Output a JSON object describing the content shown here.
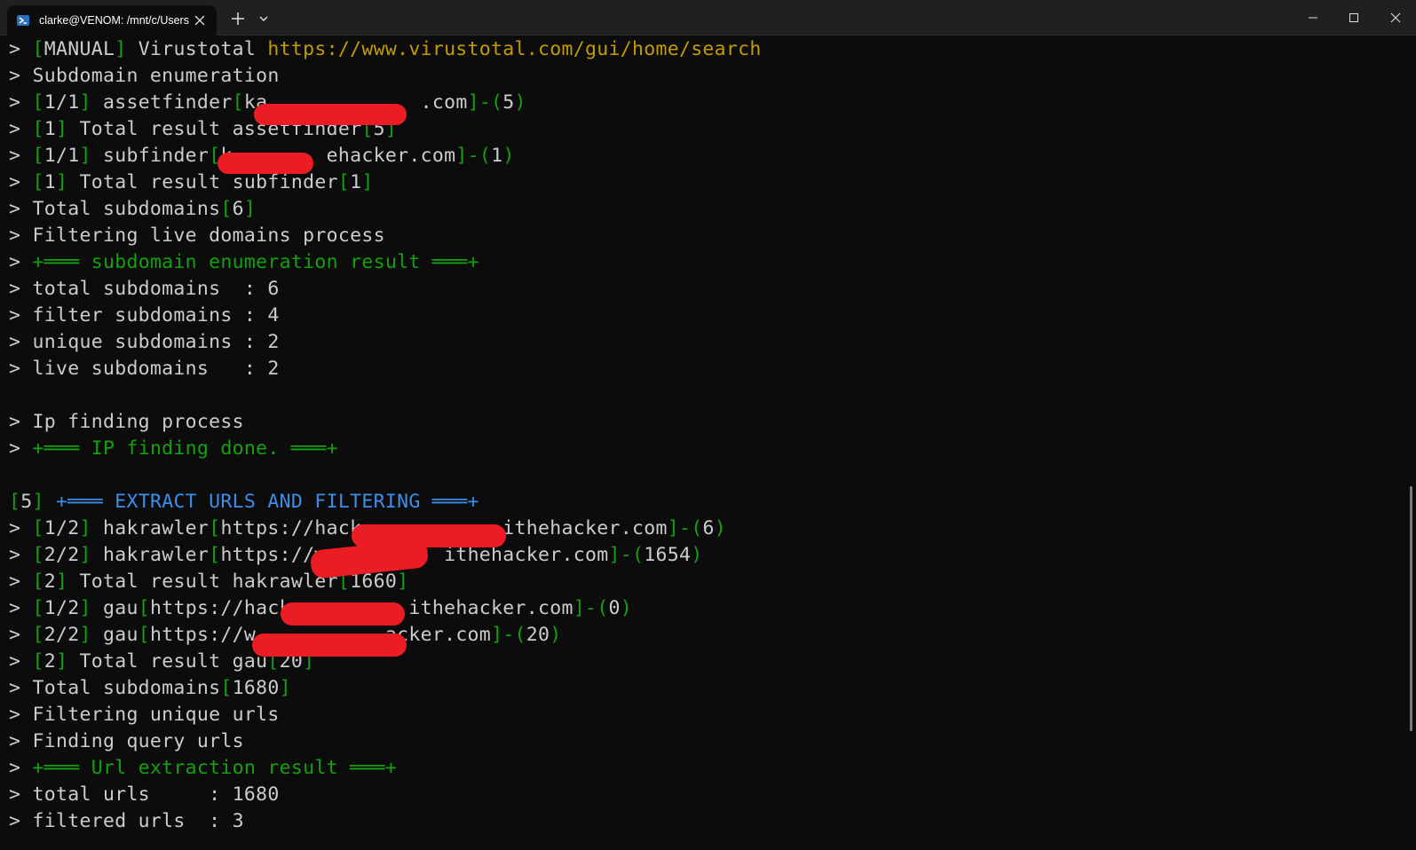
{
  "window": {
    "tab_title": "clarke@VENOM: /mnt/c/Users",
    "icons": {
      "tab": "powershell-icon",
      "close_tab": "close-icon",
      "new_tab": "plus-icon",
      "dropdown": "chevron-down-icon",
      "minimize": "minimize-icon",
      "maximize": "maximize-icon",
      "close": "close-icon"
    }
  },
  "colors": {
    "background": "#0c0c0c",
    "text": "#cccccc",
    "green": "#13a10e",
    "yellow": "#c19c00",
    "blue": "#3b8eea",
    "redaction": "#ec1c24"
  },
  "lines": [
    [
      {
        "t": "> ",
        "c": "w"
      },
      {
        "t": "[",
        "c": "g"
      },
      {
        "t": "MANUAL",
        "c": "w"
      },
      {
        "t": "]",
        "c": "g"
      },
      {
        "t": " Virustotal ",
        "c": "w"
      },
      {
        "t": "https://www.virustotal.com/gui/home/search",
        "c": "y"
      }
    ],
    [
      {
        "t": "> Subdomain enumeration",
        "c": "w"
      }
    ],
    [
      {
        "t": "> ",
        "c": "w"
      },
      {
        "t": "[",
        "c": "g"
      },
      {
        "t": "1/1",
        "c": "w"
      },
      {
        "t": "]",
        "c": "g"
      },
      {
        "t": " assetfinder",
        "c": "w"
      },
      {
        "t": "[",
        "c": "g"
      },
      {
        "t": "ka             .com",
        "c": "w"
      },
      {
        "t": "]-(",
        "c": "g"
      },
      {
        "t": "5",
        "c": "w"
      },
      {
        "t": ")",
        "c": "g"
      }
    ],
    [
      {
        "t": "> ",
        "c": "w"
      },
      {
        "t": "[",
        "c": "g"
      },
      {
        "t": "1",
        "c": "w"
      },
      {
        "t": "]",
        "c": "g"
      },
      {
        "t": " Total result assetfinder",
        "c": "w"
      },
      {
        "t": "[",
        "c": "g"
      },
      {
        "t": "5",
        "c": "w"
      },
      {
        "t": "]",
        "c": "g"
      }
    ],
    [
      {
        "t": "> ",
        "c": "w"
      },
      {
        "t": "[",
        "c": "g"
      },
      {
        "t": "1/1",
        "c": "w"
      },
      {
        "t": "]",
        "c": "g"
      },
      {
        "t": " subfinder",
        "c": "w"
      },
      {
        "t": "[",
        "c": "g"
      },
      {
        "t": "k        ehacker.com",
        "c": "w"
      },
      {
        "t": "]-(",
        "c": "g"
      },
      {
        "t": "1",
        "c": "w"
      },
      {
        "t": ")",
        "c": "g"
      }
    ],
    [
      {
        "t": "> ",
        "c": "w"
      },
      {
        "t": "[",
        "c": "g"
      },
      {
        "t": "1",
        "c": "w"
      },
      {
        "t": "]",
        "c": "g"
      },
      {
        "t": " Total result subfinder",
        "c": "w"
      },
      {
        "t": "[",
        "c": "g"
      },
      {
        "t": "1",
        "c": "w"
      },
      {
        "t": "]",
        "c": "g"
      }
    ],
    [
      {
        "t": "> Total subdomains",
        "c": "w"
      },
      {
        "t": "[",
        "c": "g"
      },
      {
        "t": "6",
        "c": "w"
      },
      {
        "t": "]",
        "c": "g"
      }
    ],
    [
      {
        "t": "> Filtering live domains process",
        "c": "w"
      }
    ],
    [
      {
        "t": "> ",
        "c": "w"
      },
      {
        "t": "+═══ subdomain enumeration result ═══+",
        "c": "g"
      }
    ],
    [
      {
        "t": "> total subdomains  : 6",
        "c": "w"
      }
    ],
    [
      {
        "t": "> filter subdomains : 4",
        "c": "w"
      }
    ],
    [
      {
        "t": "> unique subdomains : 2",
        "c": "w"
      }
    ],
    [
      {
        "t": "> live subdomains   : 2",
        "c": "w"
      }
    ],
    [],
    [
      {
        "t": "> Ip finding process",
        "c": "w"
      }
    ],
    [
      {
        "t": "> ",
        "c": "w"
      },
      {
        "t": "+═══ IP finding done. ═══+",
        "c": "g"
      }
    ],
    [],
    [
      {
        "t": "[",
        "c": "g"
      },
      {
        "t": "5",
        "c": "w"
      },
      {
        "t": "]",
        "c": "g"
      },
      {
        "t": " ",
        "c": "w"
      },
      {
        "t": "+═══ EXTRACT URLS AND FILTERING ═══+",
        "c": "b"
      }
    ],
    [
      {
        "t": "> ",
        "c": "w"
      },
      {
        "t": "[",
        "c": "g"
      },
      {
        "t": "1/2",
        "c": "w"
      },
      {
        "t": "]",
        "c": "g"
      },
      {
        "t": " hakrawler",
        "c": "w"
      },
      {
        "t": "[",
        "c": "g"
      },
      {
        "t": "https://hack            ithehacker.com",
        "c": "w"
      },
      {
        "t": "]-(",
        "c": "g"
      },
      {
        "t": "6",
        "c": "w"
      },
      {
        "t": ")",
        "c": "g"
      }
    ],
    [
      {
        "t": "> ",
        "c": "w"
      },
      {
        "t": "[",
        "c": "g"
      },
      {
        "t": "2/2",
        "c": "w"
      },
      {
        "t": "]",
        "c": "g"
      },
      {
        "t": " hakrawler",
        "c": "w"
      },
      {
        "t": "[",
        "c": "g"
      },
      {
        "t": "https://w          ithehacker.com",
        "c": "w"
      },
      {
        "t": "]-(",
        "c": "g"
      },
      {
        "t": "1654",
        "c": "w"
      },
      {
        "t": ")",
        "c": "g"
      }
    ],
    [
      {
        "t": "> ",
        "c": "w"
      },
      {
        "t": "[",
        "c": "g"
      },
      {
        "t": "2",
        "c": "w"
      },
      {
        "t": "]",
        "c": "g"
      },
      {
        "t": " Total result hakrawler",
        "c": "w"
      },
      {
        "t": "[",
        "c": "g"
      },
      {
        "t": "1660",
        "c": "w"
      },
      {
        "t": "]",
        "c": "g"
      }
    ],
    [
      {
        "t": "> ",
        "c": "w"
      },
      {
        "t": "[",
        "c": "g"
      },
      {
        "t": "1/2",
        "c": "w"
      },
      {
        "t": "]",
        "c": "g"
      },
      {
        "t": " gau",
        "c": "w"
      },
      {
        "t": "[",
        "c": "g"
      },
      {
        "t": "https://hack          ithehacker.com",
        "c": "w"
      },
      {
        "t": "]-(",
        "c": "g"
      },
      {
        "t": "0",
        "c": "w"
      },
      {
        "t": ")",
        "c": "g"
      }
    ],
    [
      {
        "t": "> ",
        "c": "w"
      },
      {
        "t": "[",
        "c": "g"
      },
      {
        "t": "2/2",
        "c": "w"
      },
      {
        "t": "]",
        "c": "g"
      },
      {
        "t": " gau",
        "c": "w"
      },
      {
        "t": "[",
        "c": "g"
      },
      {
        "t": "https://w           acker.com",
        "c": "w"
      },
      {
        "t": "]-(",
        "c": "g"
      },
      {
        "t": "20",
        "c": "w"
      },
      {
        "t": ")",
        "c": "g"
      }
    ],
    [
      {
        "t": "> ",
        "c": "w"
      },
      {
        "t": "[",
        "c": "g"
      },
      {
        "t": "2",
        "c": "w"
      },
      {
        "t": "]",
        "c": "g"
      },
      {
        "t": " Total result gau",
        "c": "w"
      },
      {
        "t": "[",
        "c": "g"
      },
      {
        "t": "20",
        "c": "w"
      },
      {
        "t": "]",
        "c": "g"
      }
    ],
    [
      {
        "t": "> Total subdomains",
        "c": "w"
      },
      {
        "t": "[",
        "c": "g"
      },
      {
        "t": "1680",
        "c": "w"
      },
      {
        "t": "]",
        "c": "g"
      }
    ],
    [
      {
        "t": "> Filtering unique urls",
        "c": "w"
      }
    ],
    [
      {
        "t": "> Finding query urls",
        "c": "w"
      }
    ],
    [
      {
        "t": "> ",
        "c": "w"
      },
      {
        "t": "+═══ Url extraction result ═══+",
        "c": "g"
      }
    ],
    [
      {
        "t": "> total urls     : 1680",
        "c": "w"
      }
    ],
    [
      {
        "t": "> filtered urls  : 3",
        "c": "w"
      }
    ]
  ]
}
